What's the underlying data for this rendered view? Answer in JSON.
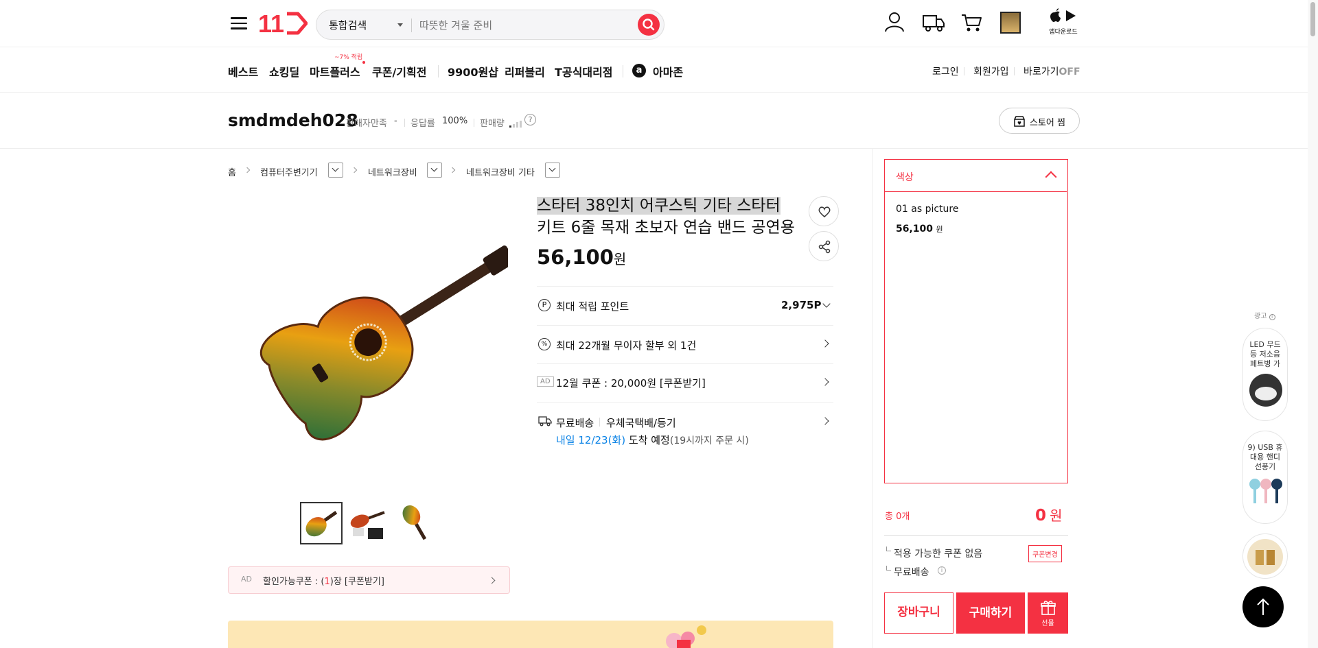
{
  "header": {
    "logo": "11",
    "search_scope": "통합검색",
    "search_placeholder": "따뜻한 겨울 준비",
    "app_download": "앱다운로드"
  },
  "nav": {
    "items": [
      "베스트",
      "쇼킹딜",
      "마트플러스",
      "쿠폰/기획전",
      "9900원샵",
      "리퍼블리",
      "T공식대리점",
      "아마존"
    ],
    "mart_badge": "~7% 적립",
    "amazon_icon": "a",
    "login": "로그인",
    "signup": "회원가입",
    "shortcut": "바로가기",
    "shortcut_state": "OFF"
  },
  "store": {
    "name": "smdmdeh028",
    "satisfaction_label": "판매자만족",
    "satisfaction_value": "-",
    "response_label": "응답률",
    "response_value": "100%",
    "sales_label": "판매량",
    "help": "?",
    "follow_button": "스토어 찜"
  },
  "breadcrumb": [
    "홈",
    "컴퓨터주변기기",
    "네트워크장비",
    "네트워크장비 기타"
  ],
  "product": {
    "title_line1": "스타터 38인치 어쿠스틱 기타 스타터",
    "title_line2": "키트 6줄 목재 초보자 연습 밴드 공연용",
    "price_number": "56,100",
    "price_unit": "원",
    "points_label": "최대 적립 포인트",
    "points_value": "2,975P",
    "installment": "최대 22개월 무이자 할부 외 1건",
    "ad_tag": "AD",
    "coupon_line": "12월 쿠폰 : 20,000원 [쿠폰받기]",
    "shipping_free": "무료배송",
    "shipping_method": "우체국택배/등기",
    "delivery_date": "내일 12/23(화)",
    "delivery_text": "도착 예정",
    "delivery_cutoff": "(19시까지 주문 시)",
    "discount_coupon_ad": "AD",
    "discount_coupon_prefix": "할인가능쿠폰 : (",
    "discount_coupon_count": "1",
    "discount_coupon_suffix": ")장 [쿠폰받기]"
  },
  "option_panel": {
    "header": "색상",
    "option_name": "01 as picture",
    "option_price": "56,100",
    "option_unit": "원",
    "total_label": "총 0개",
    "total_value": "0",
    "total_unit": "원",
    "coupon_none": "적용 가능한 쿠폰 없음",
    "coupon_change": "쿠폰변경",
    "free_shipping": "무료배송",
    "cart_button": "장바구니",
    "buy_button": "구매하기",
    "gift_button": "선물"
  },
  "side_ads": {
    "label": "광고",
    "ad1": "LED 무드등 저소음 페트병 가",
    "ad2": "9) USB 휴대용 핸디 선풍기"
  },
  "colors": {
    "brand_red": "#f43142",
    "link_blue": "#0b83e6"
  }
}
